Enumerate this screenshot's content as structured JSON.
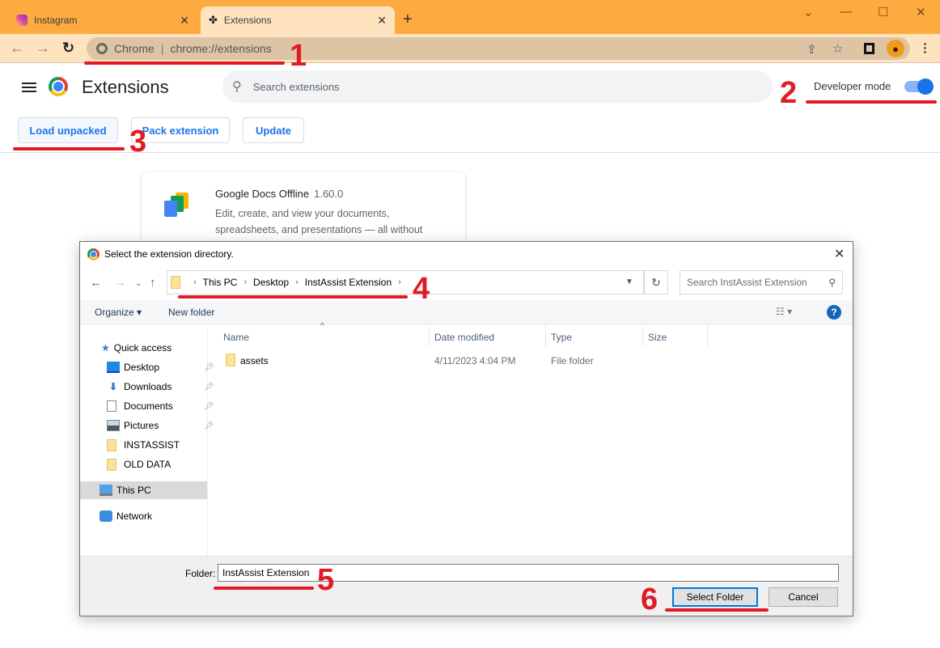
{
  "browser": {
    "tabs": [
      {
        "label": "Instagram",
        "icon": "instagram-icon",
        "active": false
      },
      {
        "label": "Extensions",
        "icon": "puzzle-piece-icon",
        "active": true
      }
    ],
    "new_tab": "+",
    "window_controls": {
      "tab_search": "⌄",
      "minimize": "—",
      "maximize": "☐",
      "close": "✕"
    },
    "omnibox": {
      "site_label": "Chrome",
      "url": "chrome://extensions"
    },
    "nav": {
      "back": "←",
      "forward": "→",
      "reload": "C"
    }
  },
  "extensions_page": {
    "title": "Extensions",
    "search_placeholder": "Search extensions",
    "developer_mode": {
      "label": "Developer mode",
      "enabled": true
    },
    "buttons": {
      "load_unpacked": "Load unpacked",
      "pack_extension": "Pack extension",
      "update": "Update"
    },
    "card": {
      "name": "Google Docs Offline",
      "version": "1.60.0",
      "description": "Edit, create, and view your documents, spreadsheets, and presentations — all without"
    }
  },
  "dialog": {
    "title": "Select the extension directory.",
    "breadcrumb": [
      "This PC",
      "Desktop",
      "InstAssist Extension"
    ],
    "search_placeholder": "Search InstAssist Extension",
    "commands": {
      "organize": "Organize ▾",
      "new_folder": "New folder",
      "help": "?"
    },
    "nav_pane": {
      "quick_access": "Quick access",
      "items": [
        {
          "label": "Desktop",
          "pinned": true
        },
        {
          "label": "Downloads",
          "pinned": true
        },
        {
          "label": "Documents",
          "pinned": true
        },
        {
          "label": "Pictures",
          "pinned": true
        },
        {
          "label": "INSTASSIST",
          "pinned": false
        },
        {
          "label": "OLD DATA",
          "pinned": false
        }
      ],
      "this_pc": "This PC",
      "network": "Network"
    },
    "columns": [
      "Name",
      "Date modified",
      "Type",
      "Size"
    ],
    "files": [
      {
        "name": "assets",
        "date_modified": "4/11/2023 4:04 PM",
        "type": "File folder",
        "size": ""
      }
    ],
    "folder_label": "Folder:",
    "folder_value": "InstAssist Extension",
    "buttons": {
      "select": "Select Folder",
      "cancel": "Cancel"
    }
  },
  "annotations": [
    "1",
    "2",
    "3",
    "4",
    "5",
    "6"
  ],
  "colors": {
    "annotation": "#e01b24",
    "tabstrip": "#fdab40",
    "toolbar": "#ffe3bf",
    "accent": "#1a73e8"
  }
}
